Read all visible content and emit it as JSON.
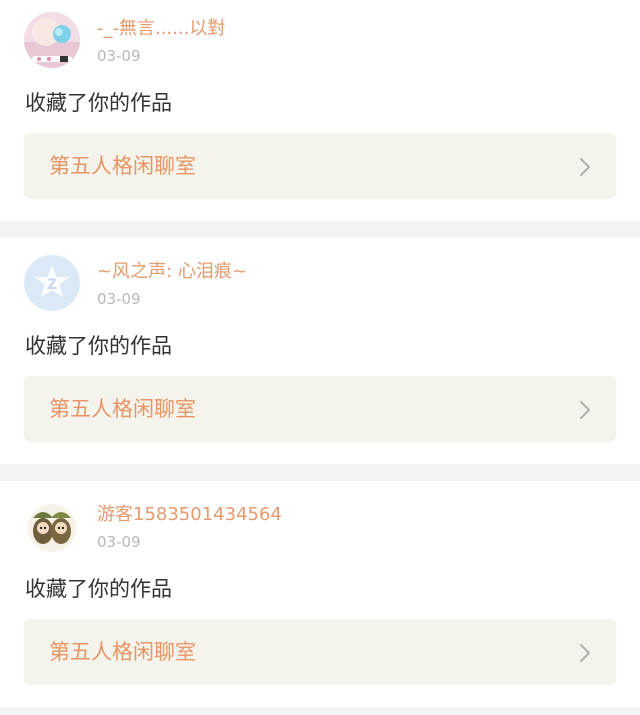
{
  "notifications": [
    {
      "username": "-_-無言......以對",
      "date": "03-09",
      "action": "收藏了你的作品",
      "work_title": "第五人格闲聊室",
      "avatar_icon": "photo-avatar"
    },
    {
      "username": "~风之声: 心泪痕~",
      "date": "03-09",
      "action": "收藏了你的作品",
      "work_title": "第五人格闲聊室",
      "avatar_icon": "default-z-avatar"
    },
    {
      "username": "游客1583501434564",
      "date": "03-09",
      "action": "收藏了你的作品",
      "work_title": "第五人格闲聊室",
      "avatar_icon": "cartoon-avatar"
    }
  ],
  "colors": {
    "username": "#e59a6e",
    "work_title": "#e89463",
    "link_background": "#f4f4ec",
    "page_background": "#f3f3f3"
  }
}
